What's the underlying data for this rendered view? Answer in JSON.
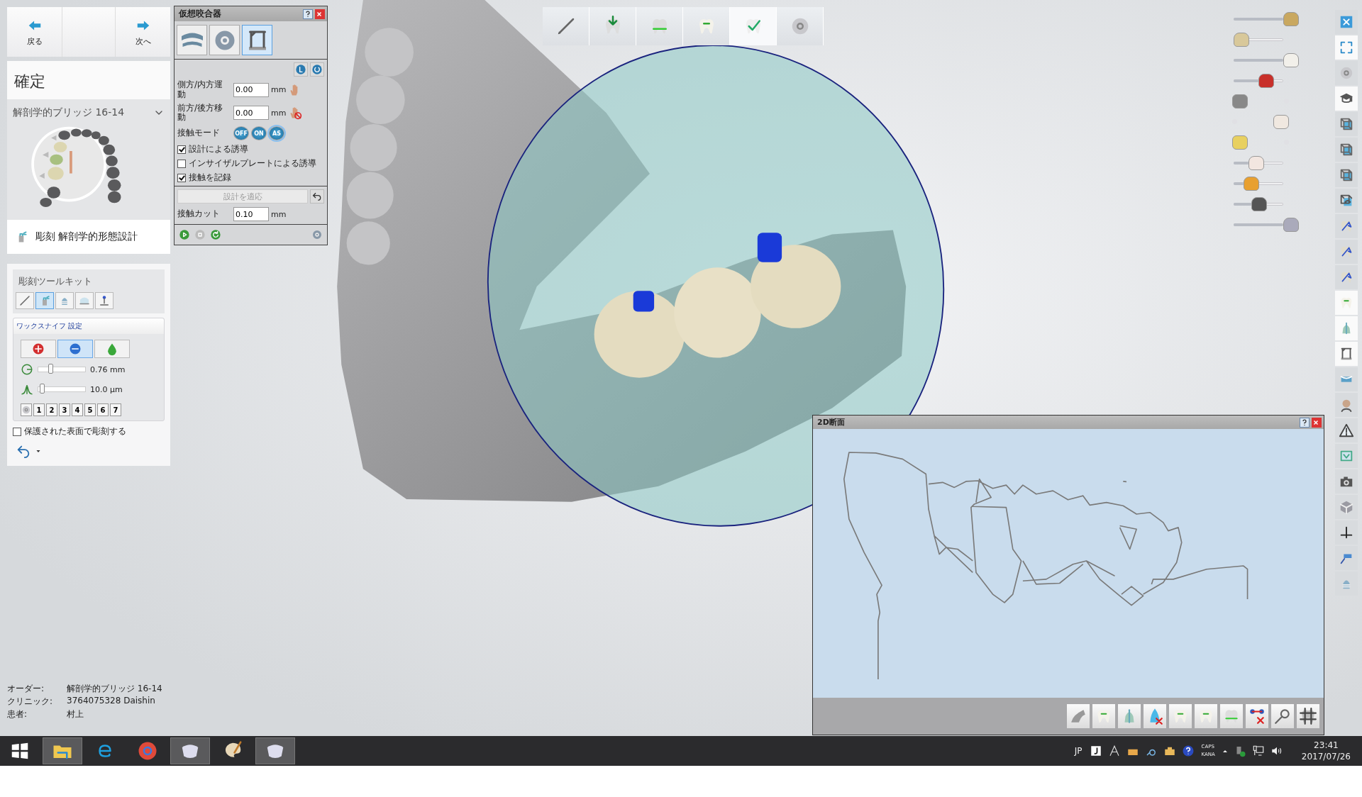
{
  "nav": {
    "back": "戻る",
    "next": "次へ"
  },
  "step_title": "確定",
  "case_name": "解剖学的ブリッジ 16-14",
  "tool_heading": "彫刻 解剖学的形態設計",
  "toolkit": {
    "title": "彫刻ツールキット",
    "tools": [
      {
        "kind": "knife",
        "selected": false
      },
      {
        "kind": "spray",
        "selected": true
      },
      {
        "kind": "implant",
        "selected": false
      },
      {
        "kind": "lens",
        "selected": false
      },
      {
        "kind": "joystick",
        "selected": false
      }
    ],
    "settings_title": "ワックスナイフ 設定",
    "modes": [
      {
        "kind": "plus",
        "selected": false
      },
      {
        "kind": "minus",
        "selected": true
      },
      {
        "kind": "drop",
        "selected": false
      }
    ],
    "sliders": [
      {
        "kind": "radius",
        "level": 0.25,
        "reading": "0.76 mm"
      },
      {
        "kind": "strength",
        "level": 0.08,
        "reading": "10.0 μm"
      }
    ],
    "presets": [
      "1",
      "2",
      "3",
      "4",
      "5",
      "6",
      "7"
    ],
    "protect": {
      "label": "保護された表面で彫刻する",
      "checked": false
    }
  },
  "order_info": [
    {
      "label": "オーダー:",
      "value": "解剖学的ブリッジ 16-14"
    },
    {
      "label": "クリニック:",
      "value": "3764075328 Daishin"
    },
    {
      "label": "患者:",
      "value": "村上"
    }
  ],
  "articulator": {
    "title": "仮想咬合器",
    "tabs": [
      {
        "kind": "jaw",
        "selected": false
      },
      {
        "kind": "gear",
        "selected": false
      },
      {
        "kind": "articulator",
        "selected": true
      }
    ],
    "fields": [
      {
        "label": "側方/内方運動",
        "value": "0.00",
        "unit": "mm",
        "kind": "hand"
      },
      {
        "label": "前方/後方移動",
        "value": "0.00",
        "unit": "mm",
        "kind": "hand-blocked"
      }
    ],
    "contact_mode": {
      "label": "接触モード",
      "options": [
        {
          "label": "OFF",
          "selected": false
        },
        {
          "label": "ON",
          "selected": false
        },
        {
          "label": "AS",
          "selected": true
        }
      ]
    },
    "checkboxes": [
      {
        "label": "設計による誘導",
        "checked": true
      },
      {
        "label": "インサイザルプレートによる誘導",
        "checked": false
      },
      {
        "label": "接触を記録",
        "checked": true
      }
    ],
    "apply": {
      "label": "設計を適応",
      "disabled": true
    },
    "contact_cut": {
      "label": "接触カット",
      "value": "0.10",
      "unit": "mm"
    }
  },
  "steps": [
    {
      "kind": "knife",
      "selected": false
    },
    {
      "kind": "tooth-arrow",
      "selected": false
    },
    {
      "kind": "tooth-band",
      "selected": false
    },
    {
      "kind": "tooth",
      "selected": false
    },
    {
      "kind": "tooth-check",
      "selected": true
    },
    {
      "kind": "disc",
      "selected": false
    }
  ],
  "visibility": [
    {
      "kind": "slider",
      "level": 1
    },
    {
      "kind": "slider",
      "level": 0
    },
    {
      "kind": "slider",
      "level": 1
    },
    {
      "kind": "slider",
      "level": 0.5
    },
    {
      "kind": "switch",
      "on": false
    },
    {
      "kind": "switch",
      "on": true
    },
    {
      "kind": "switch",
      "on": false
    },
    {
      "kind": "slider",
      "level": 0.3
    },
    {
      "kind": "slider",
      "level": 0.2
    },
    {
      "kind": "slider",
      "level": 0.35
    },
    {
      "kind": "slider",
      "level": 1
    }
  ],
  "right_toolbar": [
    {
      "kind": "close",
      "selected": false
    },
    {
      "kind": "expand",
      "selected": true
    },
    {
      "kind": "disc",
      "selected": false
    },
    {
      "kind": "cap",
      "selected": true
    },
    {
      "kind": "cube",
      "selected": false
    },
    {
      "kind": "cube",
      "selected": false
    },
    {
      "kind": "cube",
      "selected": false
    },
    {
      "kind": "cube-eye",
      "selected": false
    },
    {
      "kind": "pointer",
      "selected": false
    },
    {
      "kind": "pointer",
      "selected": false
    },
    {
      "kind": "pointer",
      "selected": false
    },
    {
      "kind": "tooth",
      "selected": true
    },
    {
      "kind": "crown",
      "selected": true
    },
    {
      "kind": "articulator",
      "selected": true
    },
    {
      "kind": "tape",
      "selected": false
    },
    {
      "kind": "face",
      "selected": false
    },
    {
      "kind": "warning",
      "selected": false
    },
    {
      "kind": "window",
      "selected": false
    },
    {
      "kind": "camera",
      "selected": false
    },
    {
      "kind": "solidcube",
      "selected": false
    },
    {
      "kind": "crosshair",
      "selected": false
    },
    {
      "kind": "tag",
      "selected": false
    },
    {
      "kind": "implant",
      "selected": false
    }
  ],
  "section": {
    "title": "2D断面"
  },
  "taskbar": {
    "apps": [
      {
        "kind": "windows",
        "active": false
      },
      {
        "kind": "folder",
        "active": true
      },
      {
        "kind": "ie",
        "active": false
      },
      {
        "kind": "chrome",
        "active": false
      },
      {
        "kind": "dental",
        "active": true
      },
      {
        "kind": "paint",
        "active": false
      },
      {
        "kind": "dental",
        "active": true
      }
    ],
    "language": "JP",
    "caps": "CAPS",
    "kana": "KANA",
    "time": "23:41",
    "date": "2017/07/26"
  }
}
